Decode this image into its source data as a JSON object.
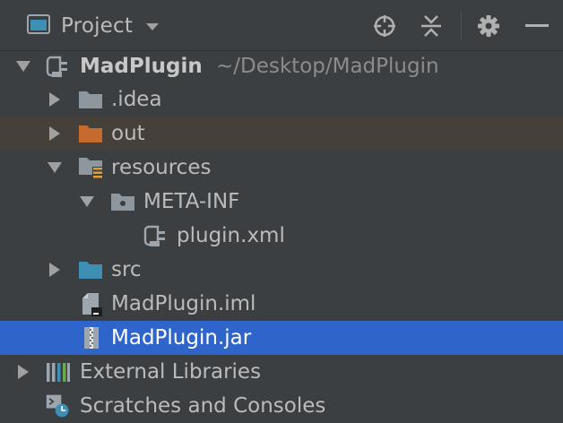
{
  "panel": {
    "title": "Project"
  },
  "tree": {
    "root": {
      "label": "MadPlugin",
      "path": "~/Desktop/MadPlugin"
    },
    "idea": {
      "label": ".idea"
    },
    "out": {
      "label": "out"
    },
    "resources": {
      "label": "resources"
    },
    "meta_inf": {
      "label": "META-INF"
    },
    "plugin_xml": {
      "label": "plugin.xml"
    },
    "src": {
      "label": "src"
    },
    "iml": {
      "label": "MadPlugin.iml"
    },
    "jar": {
      "label": "MadPlugin.jar"
    },
    "external_libraries": {
      "label": "External Libraries"
    },
    "scratches": {
      "label": "Scratches and Consoles"
    }
  },
  "colors": {
    "background": "#3c3f41",
    "selection": "#2f65ca",
    "out_row": "#45403a",
    "folder_gray": "#8e979e",
    "folder_orange": "#c56b2f",
    "folder_blue": "#3d8fb4"
  }
}
